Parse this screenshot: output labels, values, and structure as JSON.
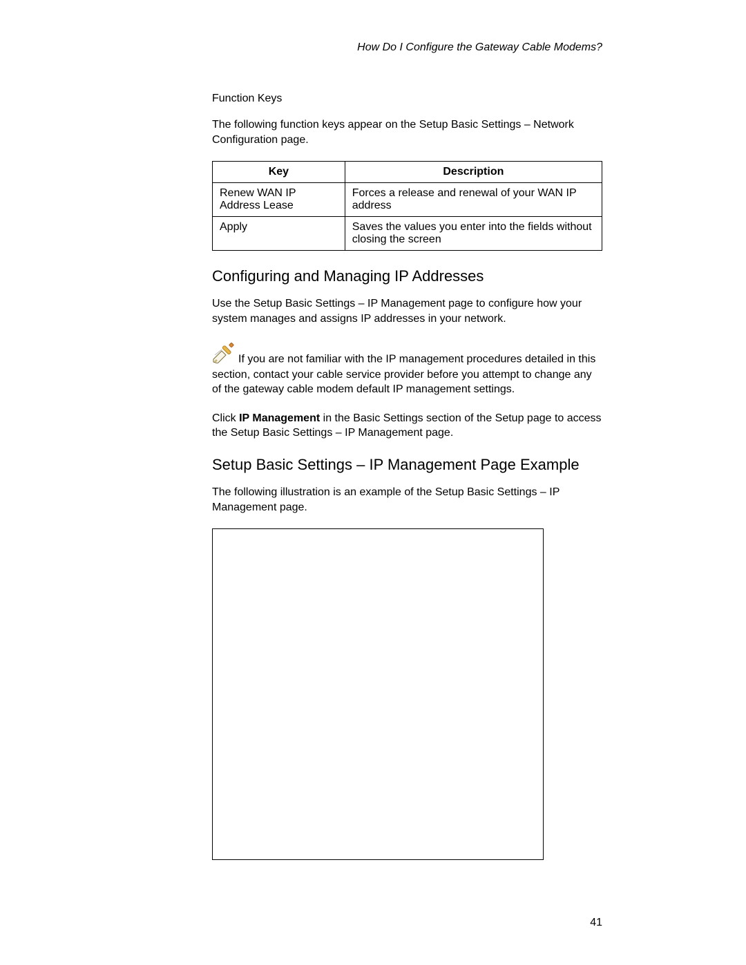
{
  "header": {
    "running_title": "How Do I Configure the Gateway Cable Modems?"
  },
  "function_keys": {
    "label": "Function Keys",
    "intro": "The following function keys appear on the Setup Basic Settings – Network Configuration page.",
    "columns": {
      "key": "Key",
      "description": "Description"
    },
    "rows": [
      {
        "key": "Renew WAN IP Address Lease",
        "description": "Forces a release and renewal of your WAN IP address"
      },
      {
        "key": "Apply",
        "description": "Saves the values you enter into the fields without closing the screen"
      }
    ]
  },
  "ip_section": {
    "heading": "Configuring and Managing IP Addresses",
    "intro": "Use the Setup Basic Settings – IP Management page to configure how your system manages and assigns IP addresses in your network.",
    "note": "If you are not familiar with the IP management procedures detailed in this section, contact your cable service provider before you attempt to change any of the gateway cable modem default IP management settings.",
    "click_prefix": "Click ",
    "click_bold": "IP Management",
    "click_suffix": " in the Basic Settings section of the Setup page to access the Setup Basic Settings – IP Management page."
  },
  "example_section": {
    "heading": "Setup Basic Settings – IP Management Page Example",
    "intro": "The following illustration is an example of the Setup Basic Settings – IP Management page."
  },
  "page_number": "41"
}
